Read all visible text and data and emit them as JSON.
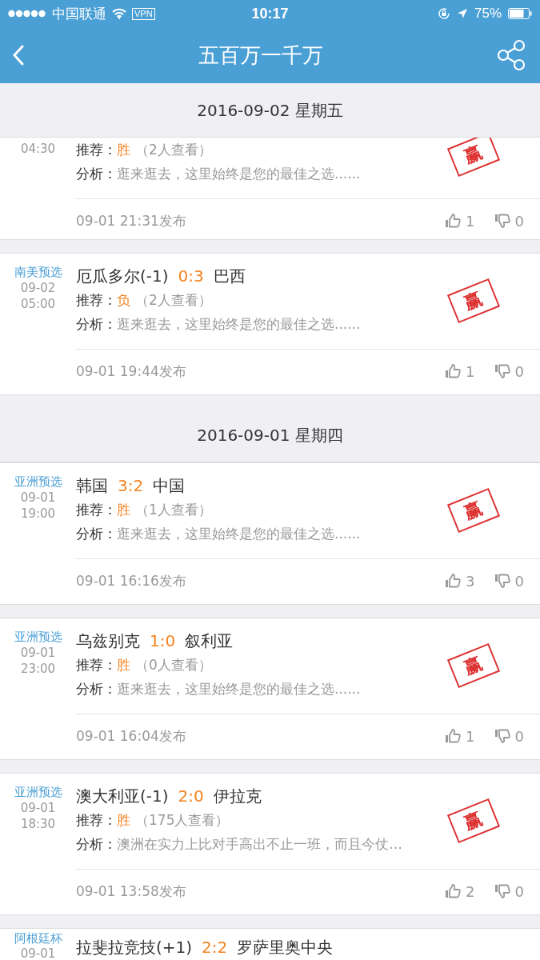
{
  "status_bar": {
    "carrier": "中国联通",
    "vpn": "VPN",
    "time": "10:17",
    "battery": "75%"
  },
  "nav": {
    "title": "五百万一千万"
  },
  "sections": [
    {
      "date": "2016-09-02 星期五",
      "cards": [
        {
          "time": "04:30",
          "recommend_label": "推荐：",
          "pick": "胜",
          "views": "（2人查看）",
          "analysis_label": "分析：",
          "analysis": "逛来逛去，这里始终是您的最佳之选......",
          "posted": "09-01 21:31发布",
          "likes": "1",
          "dislikes": "0",
          "result": "赢"
        },
        {
          "league": "南美预选",
          "date": "09-02",
          "time": "05:00",
          "home": "厄瓜多尔(-1)",
          "score": "0:3",
          "away": "巴西",
          "recommend_label": "推荐：",
          "pick": "负",
          "views": "（2人查看）",
          "analysis_label": "分析：",
          "analysis": "逛来逛去，这里始终是您的最佳之选......",
          "posted": "09-01 19:44发布",
          "likes": "1",
          "dislikes": "0",
          "result": "赢"
        }
      ]
    },
    {
      "date": "2016-09-01 星期四",
      "cards": [
        {
          "league": "亚洲预选",
          "date": "09-01",
          "time": "19:00",
          "home": "韩国",
          "score": "3:2",
          "away": "中国",
          "recommend_label": "推荐：",
          "pick": "胜",
          "views": "（1人查看）",
          "analysis_label": "分析：",
          "analysis": "逛来逛去，这里始终是您的最佳之选......",
          "posted": "09-01 16:16发布",
          "likes": "3",
          "dislikes": "0",
          "result": "赢"
        },
        {
          "league": "亚洲预选",
          "date": "09-01",
          "time": "23:00",
          "home": "乌兹别克",
          "score": "1:0",
          "away": "叙利亚",
          "recommend_label": "推荐：",
          "pick": "胜",
          "views": "（0人查看）",
          "analysis_label": "分析：",
          "analysis": "逛来逛去，这里始终是您的最佳之选......",
          "posted": "09-01 16:04发布",
          "likes": "1",
          "dislikes": "0",
          "result": "赢"
        },
        {
          "league": "亚洲预选",
          "date": "09-01",
          "time": "18:30",
          "home": "澳大利亚(-1)",
          "score": "2:0",
          "away": "伊拉克",
          "recommend_label": "推荐：",
          "pick": "胜",
          "views": "（175人查看）",
          "analysis_label": "分析：",
          "analysis": "澳洲在实力上比对手高出不止一班，而且今仗…",
          "posted": "09-01 13:58发布",
          "likes": "2",
          "dislikes": "0",
          "result": "赢"
        },
        {
          "league": "阿根廷杯",
          "date": "09-01",
          "home": "拉斐拉竞技(+1)",
          "score": "2:2",
          "away": "罗萨里奥中央"
        }
      ]
    }
  ]
}
